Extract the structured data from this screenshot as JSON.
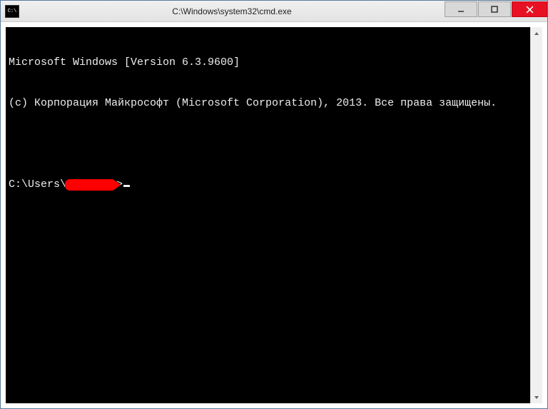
{
  "window": {
    "title": "C:\\Windows\\system32\\cmd.exe"
  },
  "console": {
    "line1": "Microsoft Windows [Version 6.3.9600]",
    "line2": "(c) Корпорация Майкрософт (Microsoft Corporation), 2013. Все права защищены.",
    "prompt_prefix": "C:\\Users\\",
    "prompt_suffix": ">"
  }
}
